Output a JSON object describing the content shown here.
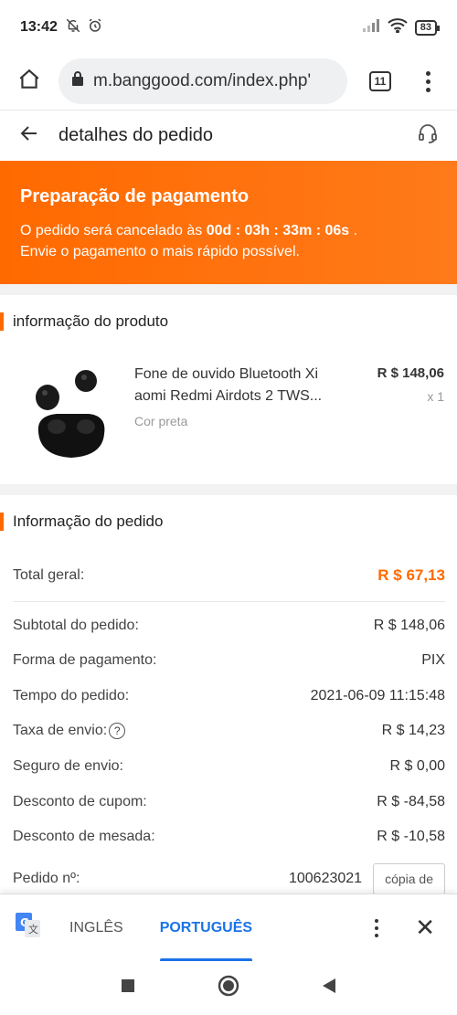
{
  "status_bar": {
    "time": "13:42",
    "battery": "83"
  },
  "browser": {
    "url": "m.banggood.com/index.php'",
    "tab_count": "11"
  },
  "page": {
    "title": "detalhes do pedido"
  },
  "banner": {
    "title": "Preparação de pagamento",
    "line1_prefix": "O pedido será cancelado às ",
    "countdown": "00d : 03h : 33m : 06s",
    "line1_suffix": " .",
    "line2": "Envie o pagamento o mais rápido possível."
  },
  "product_section": {
    "title": "informação do produto",
    "item": {
      "name": "Fone de ouvido Bluetooth Xi aomi Redmi Airdots 2 TWS...",
      "variant": "Cor preta",
      "price": "R $ 148,06",
      "qty": "x 1"
    }
  },
  "order_section": {
    "title": "Informação do pedido",
    "total": {
      "label": "Total geral:",
      "value": "R $ 67,13"
    },
    "rows": [
      {
        "label": "Subtotal do pedido:",
        "value": "R $ 148,06"
      },
      {
        "label": "Forma de pagamento:",
        "value": "PIX"
      },
      {
        "label": "Tempo do pedido:",
        "value": "2021-06-09 11:15:48"
      },
      {
        "label": "Taxa de envio:",
        "value": "R $ 14,23"
      },
      {
        "label": "Seguro de envio:",
        "value": "R $ 0,00"
      },
      {
        "label": "Desconto de cupom:",
        "value": "R $ -84,58"
      },
      {
        "label": "Desconto de mesada:",
        "value": "R $ -10,58"
      }
    ],
    "order_no": {
      "label": "Pedido nº:",
      "value": "100623021",
      "copy_label": "cópia de"
    }
  },
  "translate_bar": {
    "lang_from": "INGLÊS",
    "lang_to": "PORTUGUÊS"
  },
  "colors": {
    "accent": "#ff6a00",
    "translate_blue": "#1a73e8"
  }
}
